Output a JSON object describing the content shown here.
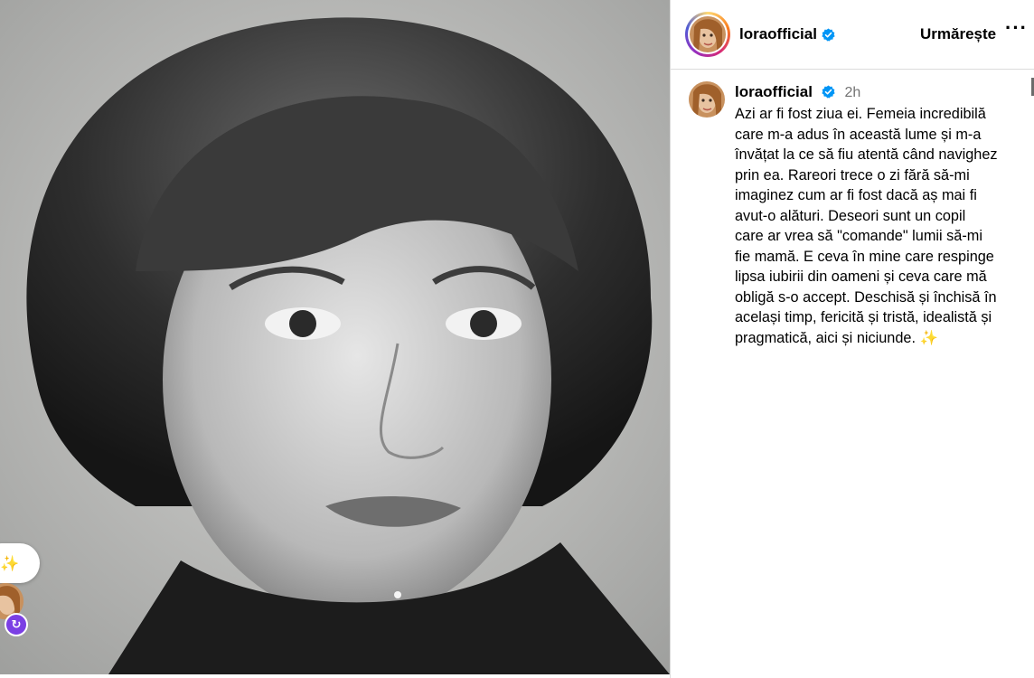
{
  "header": {
    "username": "loraofficial",
    "follow_label": "Urmărește",
    "more_label": "···"
  },
  "caption": {
    "username": "loraofficial",
    "time": "2h",
    "text": "Azi ar fi fost ziua ei. Femeia incredibilă\ncare m-a adus în această lume și m-a\nînvățat la ce să fiu atentă când navighez\nprin ea. Rareori trece o zi fără să-mi\nimaginez cum ar fi fost dacă aș mai fi\navut-o alături. Deseori sunt un copil\ncare ar vrea să \"comande\" lumii să-mi\nfie mamă. E ceva în mine care respinge\nlipsa iubirii din oameni și ceva care mă\nobligă s-o accept. Deschisă și închisă în\nacelași timp, fericită și tristă, idealistă și\npragmatică, aici și niciunde.",
    "emoji": "✨"
  },
  "overlay": {
    "pill_emoji": "✨",
    "badge_icon": "↻"
  },
  "colors": {
    "verified": "#0095f6",
    "sparkle": "#f5b700",
    "border": "#dbdbdb",
    "muted": "#737373"
  }
}
